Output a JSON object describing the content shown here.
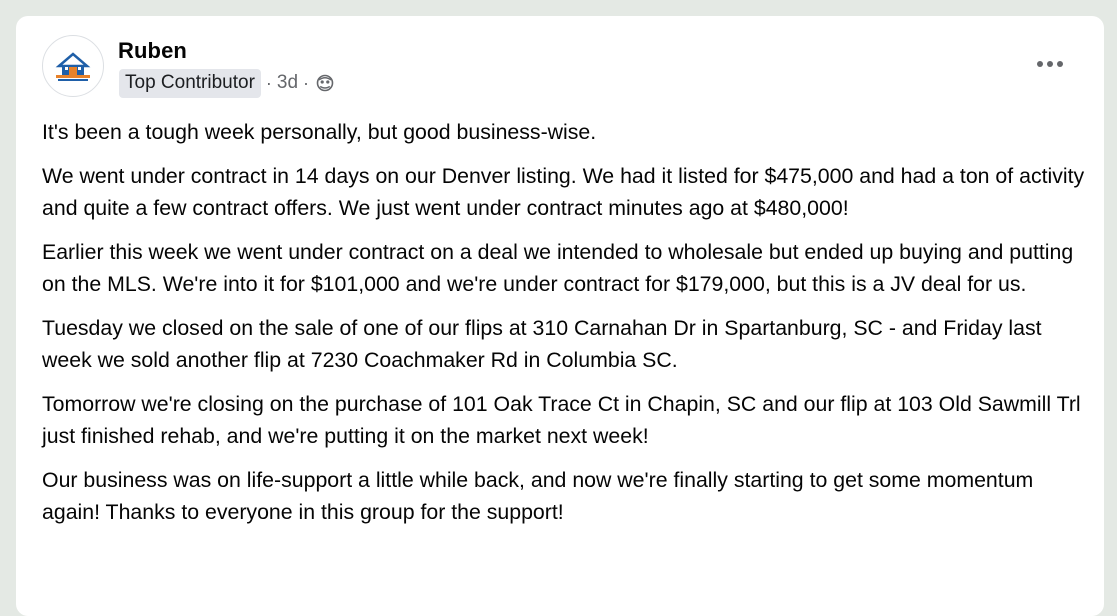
{
  "post": {
    "author": "Ruben",
    "badge": "Top Contributor",
    "separator": "·",
    "time": "3d",
    "audience_icon": "globe-icon",
    "more_icon": "more-options-icon",
    "avatar_icon": "house-logo-icon",
    "paragraphs": [
      "It's been a tough week personally, but good business-wise.",
      "We went under contract in 14 days on our Denver listing. We had it listed for $475,000 and had a ton of activity and quite a few contract offers. We just went under contract minutes ago at $480,000!",
      "Earlier this week we went under contract on a deal we intended to wholesale but ended up buying and putting on the MLS. We're into it for $101,000 and we're under contract for $179,000, but this is a JV deal for us.",
      "Tuesday we closed on the sale of one of our flips at 310 Carnahan Dr in Spartanburg, SC - and Friday last week we sold another flip at 7230 Coachmaker Rd in Columbia SC.",
      "Tomorrow we're closing on the purchase of  101 Oak Trace Ct in Chapin, SC and our flip at 103 Old Sawmill Trl just finished rehab, and we're putting it on the market next week!",
      "Our business was on life-support a little while back, and now we're finally starting to get some momentum again! Thanks to everyone in this group for the support!"
    ]
  },
  "colors": {
    "page_background": "#e4e9e4",
    "card_background": "#ffffff",
    "text_primary": "#050505",
    "text_secondary": "#65676b",
    "badge_background": "#e4e6eb",
    "logo_blue": "#1f5fa8",
    "logo_orange": "#e8822a"
  }
}
